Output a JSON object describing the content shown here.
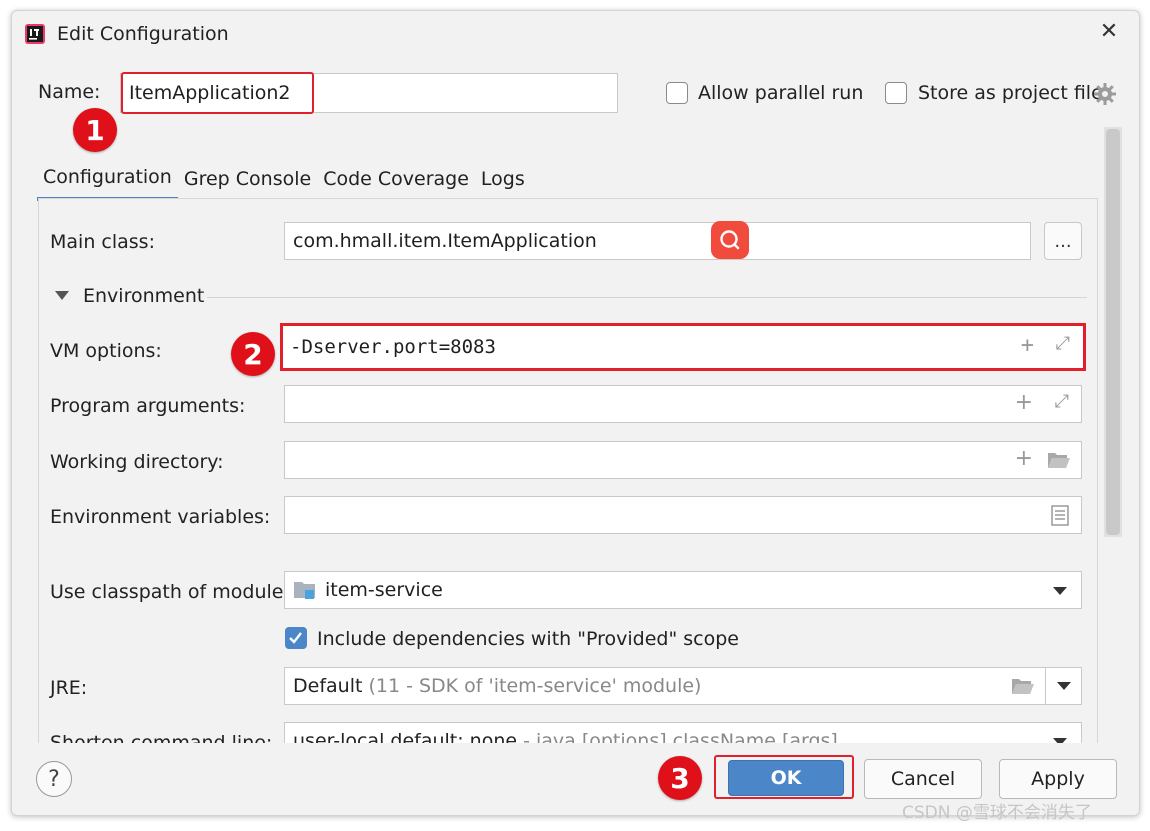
{
  "window": {
    "title": "Edit Configuration"
  },
  "header": {
    "name_label": "Name:",
    "name_value": "ItemApplication2",
    "allow_parallel_label": "Allow parallel run",
    "store_project_label": "Store as project file"
  },
  "tabs": [
    {
      "label": "Configuration",
      "active": true
    },
    {
      "label": "Grep Console"
    },
    {
      "label": "Code Coverage"
    },
    {
      "label": "Logs"
    }
  ],
  "form": {
    "main_class_label": "Main class:",
    "main_class_value": "com.hmall.item.ItemApplication",
    "browse_label": "...",
    "environment_label": "Environment",
    "vm_options_label": "VM options:",
    "vm_options_value": "-Dserver.port=8083",
    "program_args_label": "Program arguments:",
    "working_dir_label": "Working directory:",
    "env_vars_label": "Environment variables:",
    "classpath_label": "Use classpath of module:",
    "classpath_value": "item-service",
    "include_deps_label": "Include dependencies with \"Provided\" scope",
    "jre_label": "JRE:",
    "jre_default": "Default",
    "jre_detail": "(11 - SDK of 'item-service' module)",
    "shorten_label": "Shorten command line:",
    "shorten_value": "user-local default: none",
    "shorten_detail": "- java [options] className [args]"
  },
  "buttons": {
    "help": "?",
    "ok": "OK",
    "cancel": "Cancel",
    "apply": "Apply"
  },
  "annotations": {
    "badge1": "1",
    "badge2": "2",
    "badge3": "3"
  },
  "watermark": "CSDN @雪球不会消失了",
  "colors": {
    "accent": "#4a86c8",
    "annotation_red": "#e0101a"
  }
}
